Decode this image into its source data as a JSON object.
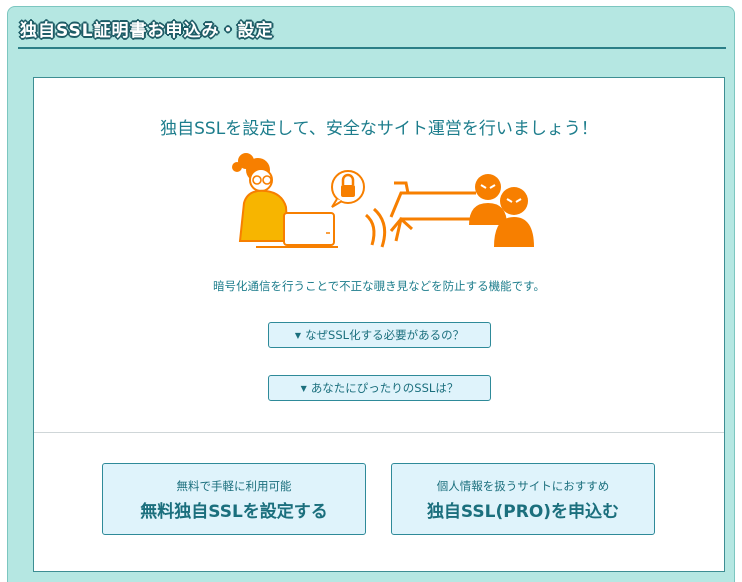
{
  "header": {
    "title": "独自SSL証明書お申込み・設定"
  },
  "intro": {
    "headline": "独自SSLを設定して、安全なサイト運営を行いましょう！",
    "description": "暗号化通信を行うことで不正な覗き見などを防止する機能です。"
  },
  "faq": {
    "why_label": "なぜSSL化する必要があるの？",
    "which_label": "あなたにぴったりのSSLは？"
  },
  "actions": {
    "free": {
      "sub": "無料で手軽に利用可能",
      "main": "無料独自SSLを設定する"
    },
    "pro": {
      "sub": "個人情報を扱うサイトにおすすめ",
      "main": "独自SSL(PRO)を申込む"
    }
  },
  "colors": {
    "accent": "#1d7d8c",
    "panel": "#b5e7e2",
    "orange": "#f77f00"
  },
  "icons": [
    "person-at-laptop-icon",
    "lock-bubble-icon",
    "arrow-icon",
    "attacker-icon"
  ]
}
